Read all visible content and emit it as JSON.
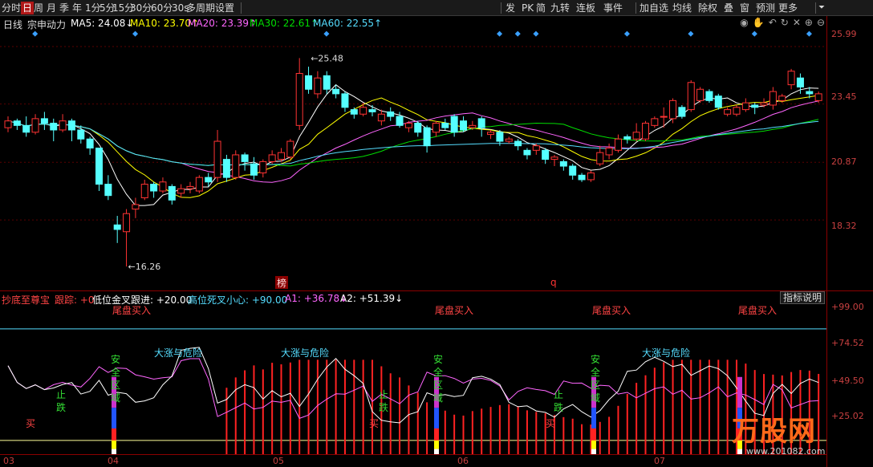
{
  "toolbar": {
    "items": [
      "分时",
      "日",
      "周",
      "月",
      "季",
      "年",
      "1分",
      "5分",
      "15分",
      "30分",
      "60分",
      "30s",
      "多周期",
      "设置"
    ],
    "active": "日",
    "right": [
      "发",
      "PK",
      "简",
      "九转",
      "连板",
      "事件",
      "加自选",
      "均线",
      "除权",
      "叠",
      "窗",
      "预测",
      "更多"
    ]
  },
  "header": {
    "period": "日线",
    "name": "宗申动力",
    "ma5": "MA5: 24.08↓",
    "ma10": "MA10: 23.70↑",
    "ma20": "MA20: 23.39↑",
    "ma30": "MA30: 22.61↑",
    "ma60": "MA60: 22.55↑"
  },
  "colors": {
    "ma5": "#ffffff",
    "ma10": "#ffff00",
    "ma20": "#ff66ff",
    "ma30": "#00dd00",
    "ma60": "#55ddff",
    "up": "#ff3333",
    "down": "#55ffff"
  },
  "price_axis": [
    "25.99",
    "23.45",
    "20.87",
    "18.32"
  ],
  "annotations": {
    "high": "25.48",
    "low": "16.26",
    "bang": "榜",
    "q": "q"
  },
  "sub": {
    "name": "抄底至尊宝",
    "track": "跟踪: +0",
    "l1": "低位金叉跟进: +20.00",
    "l2": "高位死叉小心: +90.00",
    "a1": "A1: +36.78↓",
    "a2": "A2: +51.39↓",
    "button": "指标说明",
    "axis": [
      "+99.00",
      "+74.52",
      "+49.50",
      "+25.02"
    ]
  },
  "signals": {
    "buy_tail": "尾盘买入",
    "danger": "大涨与危险",
    "stop": "止跌",
    "buy": "买",
    "safe": "安全区域"
  },
  "xaxis": [
    "03",
    "04",
    "05",
    "06",
    "07"
  ],
  "watermark": {
    "name": "万股网",
    "url": "www.201082.com"
  },
  "chart_data": {
    "type": "candlestick",
    "candles": [
      [
        22.4,
        22.7,
        22.9,
        22.2
      ],
      [
        22.7,
        22.5,
        22.8,
        22.3
      ],
      [
        22.5,
        22.2,
        22.9,
        22.0
      ],
      [
        22.2,
        22.8,
        23.0,
        22.1
      ],
      [
        22.8,
        22.6,
        23.1,
        22.3
      ],
      [
        22.6,
        22.3,
        22.8,
        21.8
      ],
      [
        22.3,
        22.7,
        23.0,
        22.2
      ],
      [
        22.7,
        22.3,
        22.8,
        21.8
      ],
      [
        22.3,
        21.9,
        22.5,
        21.7
      ],
      [
        21.9,
        21.5,
        22.0,
        21.2
      ],
      [
        21.5,
        19.9,
        21.5,
        19.6
      ],
      [
        19.9,
        19.4,
        20.3,
        19.2
      ],
      [
        18.1,
        17.9,
        18.5,
        17.3
      ],
      [
        17.8,
        18.6,
        18.8,
        16.26
      ],
      [
        18.8,
        19.0,
        19.3,
        18.4
      ],
      [
        19.3,
        19.9,
        20.1,
        19.2
      ],
      [
        19.9,
        19.6,
        20.0,
        19.3
      ],
      [
        19.6,
        20.0,
        20.2,
        19.5
      ],
      [
        19.8,
        19.2,
        19.9,
        19.0
      ],
      [
        19.5,
        19.7,
        19.9,
        19.3
      ],
      [
        19.7,
        19.8,
        20.0,
        19.5
      ],
      [
        19.6,
        20.2,
        20.3,
        19.5
      ],
      [
        20.2,
        20.0,
        20.4,
        19.8
      ],
      [
        20.2,
        21.8,
        22.3,
        20.0
      ],
      [
        21.0,
        20.2,
        21.2,
        20.0
      ],
      [
        20.2,
        21.2,
        21.4,
        20.1
      ],
      [
        21.2,
        20.9,
        21.3,
        20.5
      ],
      [
        20.8,
        20.3,
        21.1,
        20.1
      ],
      [
        20.4,
        20.9,
        21.0,
        20.2
      ],
      [
        20.9,
        21.2,
        21.4,
        20.8
      ],
      [
        21.0,
        21.3,
        21.5,
        20.9
      ],
      [
        21.1,
        21.8,
        21.9,
        21.0
      ],
      [
        22.5,
        24.8,
        25.48,
        22.3
      ],
      [
        24.7,
        24.1,
        25.1,
        23.9
      ],
      [
        23.9,
        24.6,
        24.9,
        23.7
      ],
      [
        24.7,
        24.1,
        24.9,
        23.9
      ],
      [
        24.1,
        23.9,
        24.3,
        23.7
      ],
      [
        23.9,
        23.3,
        24.0,
        23.1
      ],
      [
        23.2,
        23.0,
        23.3,
        22.8
      ],
      [
        23.0,
        23.3,
        23.5,
        22.9
      ],
      [
        23.2,
        23.1,
        23.4,
        22.9
      ],
      [
        22.7,
        23.0,
        23.2,
        22.5
      ],
      [
        23.1,
        22.9,
        23.3,
        22.7
      ],
      [
        22.9,
        22.5,
        23.1,
        22.4
      ],
      [
        22.4,
        22.6,
        22.7,
        22.2
      ],
      [
        22.6,
        22.2,
        22.7,
        22.0
      ],
      [
        22.4,
        21.6,
        22.5,
        21.3
      ],
      [
        22.2,
        22.6,
        22.7,
        22.0
      ],
      [
        22.6,
        22.4,
        22.8,
        22.3
      ],
      [
        22.9,
        22.2,
        23.0,
        22.0
      ],
      [
        22.7,
        22.3,
        22.9,
        22.2
      ],
      [
        22.4,
        22.5,
        22.7,
        22.3
      ],
      [
        22.8,
        22.4,
        22.9,
        22.0
      ],
      [
        22.1,
        22.2,
        22.3,
        21.9
      ],
      [
        22.2,
        21.8,
        22.3,
        21.6
      ],
      [
        21.8,
        21.9,
        22.0,
        21.7
      ],
      [
        21.8,
        21.6,
        21.9,
        21.4
      ],
      [
        21.4,
        21.2,
        21.5,
        21.0
      ],
      [
        21.4,
        21.6,
        21.7,
        21.2
      ],
      [
        21.4,
        21.0,
        21.5,
        20.8
      ],
      [
        21.0,
        21.1,
        21.2,
        20.7
      ],
      [
        20.9,
        20.7,
        21.0,
        20.5
      ],
      [
        20.7,
        20.3,
        20.8,
        20.1
      ],
      [
        20.3,
        20.1,
        20.4,
        20.0
      ],
      [
        20.1,
        20.4,
        20.5,
        20.0
      ],
      [
        20.8,
        21.3,
        21.6,
        20.7
      ],
      [
        21.2,
        21.5,
        21.7,
        21.0
      ],
      [
        21.4,
        21.9,
        22.1,
        21.3
      ],
      [
        22.0,
        21.9,
        22.1,
        21.7
      ],
      [
        21.9,
        22.2,
        22.6,
        21.8
      ],
      [
        21.9,
        22.6,
        22.7,
        21.8
      ],
      [
        22.5,
        22.8,
        22.9,
        22.4
      ],
      [
        22.9,
        22.9,
        23.3,
        22.4
      ],
      [
        22.8,
        23.6,
        23.7,
        22.6
      ],
      [
        23.3,
        22.9,
        23.4,
        22.8
      ],
      [
        23.2,
        24.4,
        24.5,
        23.1
      ],
      [
        23.6,
        24.1,
        24.2,
        23.5
      ],
      [
        24.0,
        23.6,
        24.1,
        23.5
      ],
      [
        23.8,
        23.3,
        23.9,
        23.2
      ],
      [
        23.0,
        23.2,
        23.3,
        22.9
      ],
      [
        23.0,
        23.3,
        23.4,
        22.9
      ],
      [
        23.2,
        23.5,
        23.7,
        23.1
      ],
      [
        23.4,
        23.3,
        23.5,
        23.0
      ],
      [
        23.4,
        23.5,
        23.7,
        23.3
      ],
      [
        23.4,
        24.0,
        24.2,
        23.2
      ],
      [
        23.6,
        23.8,
        23.9,
        23.5
      ],
      [
        24.3,
        24.9,
        25.0,
        24.1
      ],
      [
        24.6,
        24.2,
        24.8,
        23.9
      ],
      [
        24.0,
        23.9,
        24.2,
        23.7
      ],
      [
        23.6,
        23.9,
        24.0,
        23.5
      ]
    ],
    "ylim": [
      15.2,
      26.7
    ],
    "sub_ylim": [
      17.0,
      104.0
    ]
  }
}
